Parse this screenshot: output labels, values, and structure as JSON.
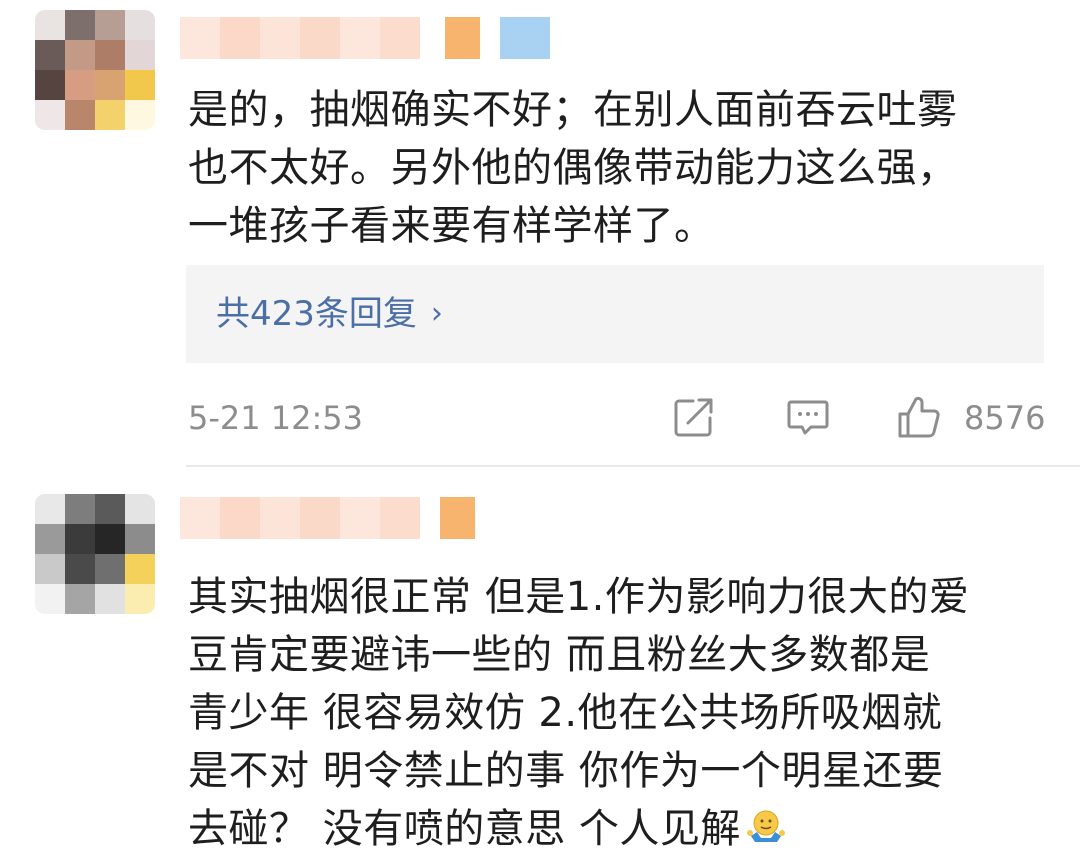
{
  "comments": [
    {
      "text_lines": [
        "是的，抽烟确实不好；在别人面前吞云吐雾",
        "也不太好。另外他的偶像带动能力这么强，",
        "一堆孩子看来要有样学样了。"
      ],
      "replies_label": "共423条回复",
      "replies_chevron": "›",
      "time": "5-21 12:53",
      "like_count": "8576",
      "icons": [
        "share-icon",
        "comment-icon",
        "like-icon"
      ]
    },
    {
      "text_lines": [
        "其实抽烟很正常 但是1.作为影响力很大的爱",
        "豆肯定要避讳一些的 而且粉丝大多数都是",
        "青少年 很容易效仿 2.他在公共场所吸烟就",
        "是不对 明令禁止的事 你作为一个明星还要",
        "去碰？ 没有喷的意思 个人见解"
      ],
      "trailing_emoji": "shrug-emoji"
    }
  ],
  "colors": {
    "text": "#1e1e1e",
    "link": "#4a6ea6",
    "meta": "#8d8d8d",
    "reply_box_bg": "#f4f4f4",
    "divider": "#e9e9e9"
  }
}
